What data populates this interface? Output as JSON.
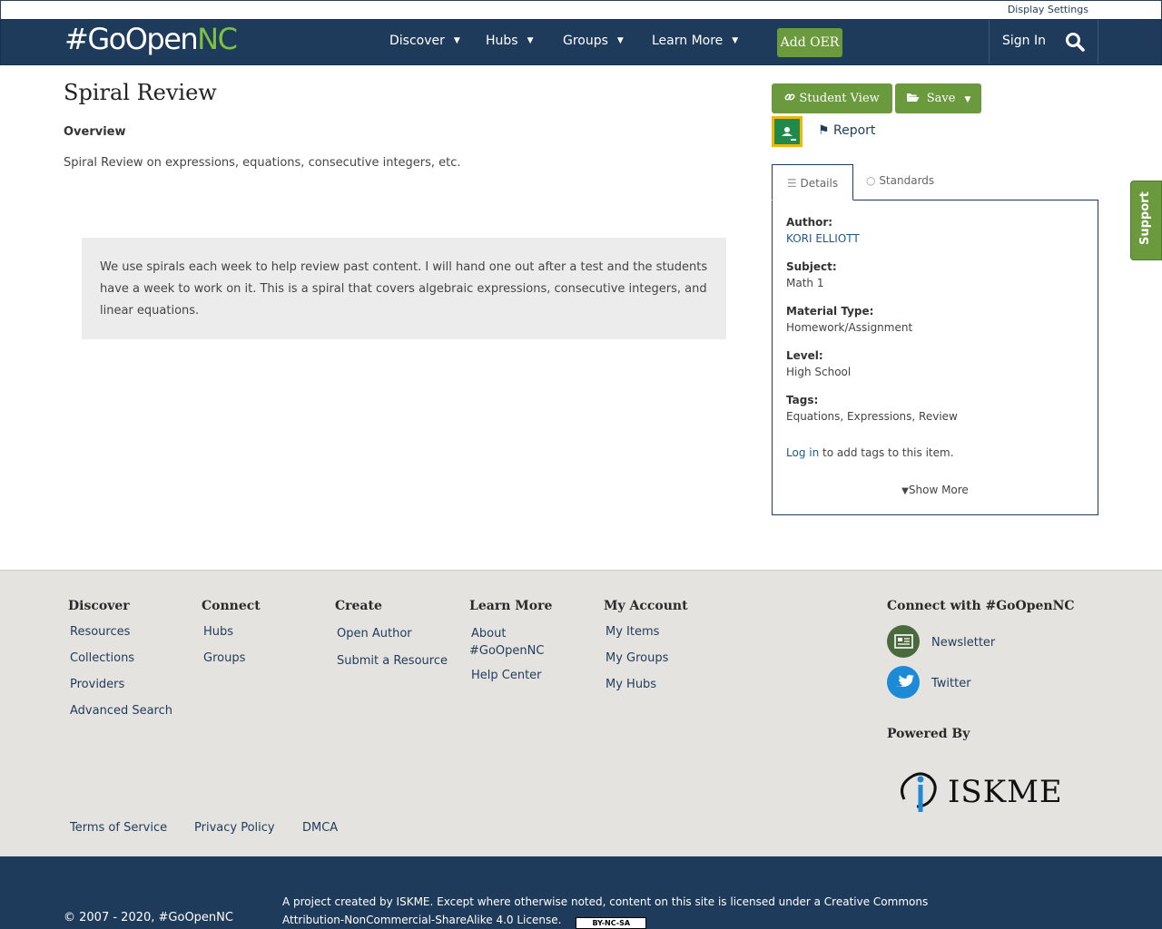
{
  "utility": {
    "display_settings": "Display Settings"
  },
  "nav": {
    "logo_prefix": "#GoOpen",
    "logo_suffix": "NC",
    "items": [
      {
        "label": "Discover"
      },
      {
        "label": "Hubs"
      },
      {
        "label": "Groups"
      },
      {
        "label": "Learn More"
      }
    ],
    "add_oer": "Add OER",
    "sign_in": "Sign In"
  },
  "resource": {
    "title": "Spiral Review",
    "overview_label": "Overview",
    "overview": "Spiral Review on expressions, equations, consecutive integers, etc.",
    "description": "We use spirals each week to help review past content. I will hand one out after a test and the students have a week to work on it. This is a spiral that covers algebraic expressions, consecutive integers, and linear equations."
  },
  "actions": {
    "student_view": "Student View",
    "save": "Save",
    "report": "Report"
  },
  "tabs": {
    "details": "Details",
    "standards": "Standards"
  },
  "details": {
    "author_label": "Author:",
    "author": "KORI ELLIOTT",
    "subject_label": "Subject:",
    "subject": "Math 1",
    "material_label": "Material Type:",
    "material": "Homework/Assignment",
    "level_label": "Level:",
    "level": "High School",
    "tags_label": "Tags:",
    "tags": "Equations, Expressions, Review",
    "login_link": "Log in",
    "login_suffix": " to add tags to this item.",
    "show_more": "Show More"
  },
  "support": "Support",
  "footer": {
    "discover": {
      "heading": "Discover",
      "links": [
        "Resources",
        "Collections",
        "Providers",
        "Advanced Search"
      ]
    },
    "connect": {
      "heading": "Connect",
      "links": [
        "Hubs",
        "Groups"
      ]
    },
    "create": {
      "heading": "Create",
      "links": [
        "Open Author",
        "Submit a Resource"
      ]
    },
    "learn": {
      "heading": "Learn More",
      "links": [
        "About #GoOpenNC",
        "Help Center"
      ]
    },
    "account": {
      "heading": "My Account",
      "links": [
        "My Items",
        "My Groups",
        "My Hubs"
      ]
    },
    "social": {
      "heading": "Connect with #GoOpenNC",
      "newsletter": "Newsletter",
      "twitter": "Twitter"
    },
    "powered_by": "Powered By",
    "iskme": "ISKME",
    "legal": [
      "Terms of Service",
      "Privacy Policy",
      "DMCA"
    ]
  },
  "bottom": {
    "copyright": "© 2007 - 2020, #GoOpenNC",
    "license": "A project created by ISKME. Except where otherwise noted, content on this site is licensed under a Creative Commons Attribution-NonCommercial-ShareAlike 4.0 License.",
    "cc_badge": "BY-NC-SA"
  },
  "colors": {
    "navy": "#1f3b5c",
    "green": "#6a9a3d",
    "nc_green": "#7dc143",
    "footer_bg": "#e5e3df"
  }
}
